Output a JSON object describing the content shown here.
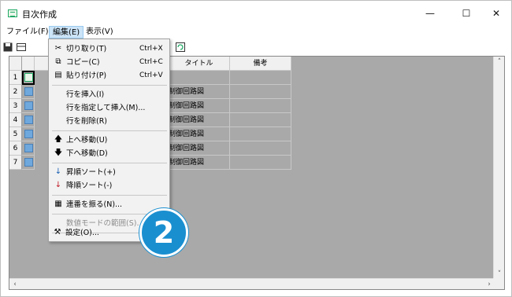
{
  "window": {
    "title": "目次作成",
    "controls": {
      "minimize": "—",
      "maximize": "☐",
      "close": "✕"
    }
  },
  "menubar": {
    "items": [
      {
        "label": "ファイル(F)"
      },
      {
        "label": "編集(E)",
        "active": true
      },
      {
        "label": "表示(V)"
      }
    ]
  },
  "table": {
    "headers": {
      "title": "タイトル",
      "note": "備考"
    },
    "rows": [
      {
        "num": "1",
        "title": "",
        "icon": "green"
      },
      {
        "num": "2",
        "title": "制御回路図",
        "icon": "blue"
      },
      {
        "num": "3",
        "title": "制御回路図",
        "icon": "blue"
      },
      {
        "num": "4",
        "title": "制御回路図",
        "icon": "blue"
      },
      {
        "num": "5",
        "title": "制御回路図",
        "icon": "blue"
      },
      {
        "num": "6",
        "title": "制御回路図",
        "icon": "blue"
      },
      {
        "num": "7",
        "title": "制御回路図",
        "icon": "blue"
      }
    ]
  },
  "edit_menu": {
    "cut": {
      "label": "切り取り(T)",
      "shortcut": "Ctrl+X",
      "icon": "scissors-icon"
    },
    "copy": {
      "label": "コピー(C)",
      "shortcut": "Ctrl+C",
      "icon": "copy-icon"
    },
    "paste": {
      "label": "貼り付け(P)",
      "shortcut": "Ctrl+V",
      "icon": "paste-icon"
    },
    "insert_row": {
      "label": "行を挿入(I)"
    },
    "insert_row_at": {
      "label": "行を指定して挿入(M)..."
    },
    "delete_row": {
      "label": "行を削除(R)"
    },
    "move_up": {
      "label": "上へ移動(U)",
      "icon": "arrow-up-icon"
    },
    "move_down": {
      "label": "下へ移動(D)",
      "icon": "arrow-down-icon"
    },
    "sort_asc": {
      "label": "昇順ソート(+)",
      "icon": "sort-ascending-icon"
    },
    "sort_desc": {
      "label": "降順ソート(-)",
      "icon": "sort-descending-icon"
    },
    "numbering": {
      "label": "連番を振る(N)...",
      "icon": "numbering-icon"
    },
    "numeric_range": {
      "label": "数値モードの範囲(S)...",
      "disabled": true
    },
    "settings": {
      "label": "設定(O)...",
      "icon": "settings-tools-icon"
    }
  },
  "step_badge": "2",
  "colors": {
    "accent": "#1a8fd0",
    "menu_highlight": "#cce4f7",
    "grid_bg": "#a9a9a9"
  }
}
